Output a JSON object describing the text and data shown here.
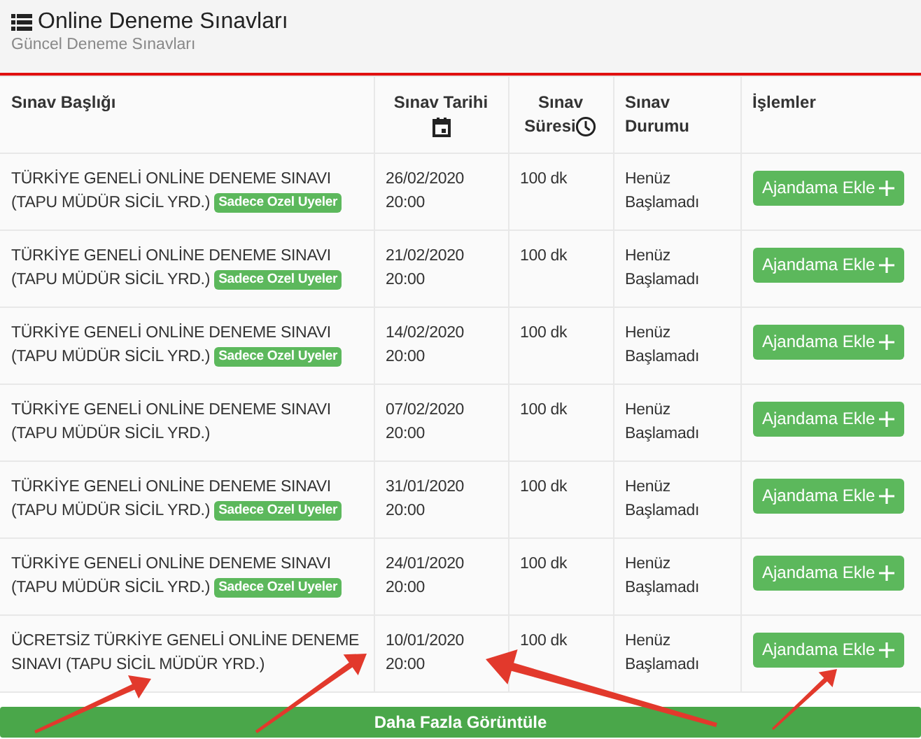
{
  "header": {
    "title": "Online Deneme Sınavları",
    "subtitle": "Güncel Deneme Sınavları"
  },
  "table": {
    "columns": [
      "Sınav Başlığı",
      "Sınav Tarihi",
      "Sınav Süresi",
      "Sınav Durumu",
      "İşlemler"
    ],
    "rows": [
      {
        "title": "TÜRKİYE GENELİ ONLİNE DENEME SINAVI (TAPU MÜDÜR SİCİL YRD.)",
        "badge": "Sadece Ozel Uyeler",
        "date": "26/02/2020",
        "time": "20:00",
        "duration": "100 dk",
        "status": "Henüz Başlamadı",
        "action": "Ajandama Ekle"
      },
      {
        "title": "TÜRKİYE GENELİ ONLİNE DENEME SINAVI (TAPU MÜDÜR SİCİL YRD.)",
        "badge": "Sadece Ozel Uyeler",
        "date": "21/02/2020",
        "time": "20:00",
        "duration": "100 dk",
        "status": "Henüz Başlamadı",
        "action": "Ajandama Ekle"
      },
      {
        "title": "TÜRKİYE GENELİ ONLİNE DENEME SINAVI (TAPU MÜDÜR SİCİL YRD.)",
        "badge": "Sadece Ozel Uyeler",
        "date": "14/02/2020",
        "time": "20:00",
        "duration": "100 dk",
        "status": "Henüz Başlamadı",
        "action": "Ajandama Ekle"
      },
      {
        "title": "TÜRKİYE GENELİ ONLİNE DENEME SINAVI (TAPU MÜDÜR SİCİL YRD.)",
        "date": "07/02/2020",
        "time": "20:00",
        "duration": "100 dk",
        "status": "Henüz Başlamadı",
        "action": "Ajandama Ekle"
      },
      {
        "title": "TÜRKİYE GENELİ ONLİNE DENEME SINAVI (TAPU MÜDÜR SİCİL YRD.)",
        "badge": "Sadece Ozel Uyeler",
        "date": "31/01/2020",
        "time": "20:00",
        "duration": "100 dk",
        "status": "Henüz Başlamadı",
        "action": "Ajandama Ekle"
      },
      {
        "title": "TÜRKİYE GENELİ ONLİNE DENEME SINAVI (TAPU MÜDÜR SİCİL YRD.)",
        "badge": "Sadece Ozel Uyeler",
        "date": "24/01/2020",
        "time": "20:00",
        "duration": "100 dk",
        "status": "Henüz Başlamadı",
        "action": "Ajandama Ekle"
      },
      {
        "title": "ÜCRETSİZ TÜRKİYE GENELİ ONLİNE DENEME SINAVI (TAPU SİCİL MÜDÜR YRD.)",
        "date": "10/01/2020",
        "time": "20:00",
        "duration": "100 dk",
        "status": "Henüz Başlamadı",
        "action": "Ajandama Ekle"
      }
    ]
  },
  "more_button": "Daha Fazla Görüntüle"
}
